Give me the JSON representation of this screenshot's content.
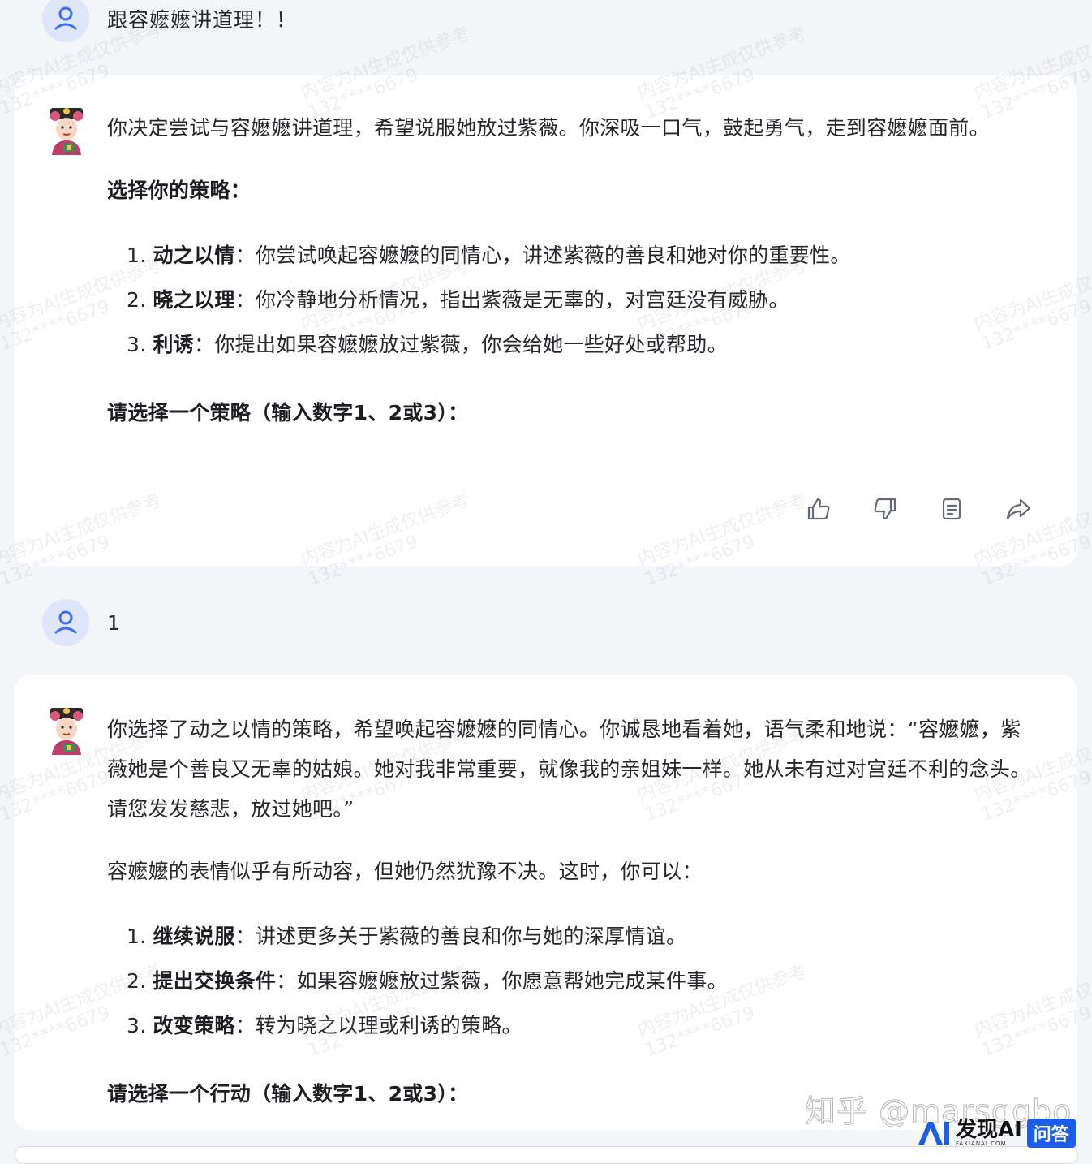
{
  "messages": {
    "user_1": {
      "text": "跟容嬷嬷讲道理！！"
    },
    "bot_1": {
      "intro": "你决定尝试与容嬷嬷讲道理，希望说服她放过紫薇。你深吸一口气，鼓起勇气，走到容嬷嬷面前。",
      "heading": "选择你的策略：",
      "options": [
        {
          "num": "1.",
          "title": "动之以情",
          "desc": "：你尝试唤起容嬷嬷的同情心，讲述紫薇的善良和她对你的重要性。"
        },
        {
          "num": "2.",
          "title": "晓之以理",
          "desc": "：你冷静地分析情况，指出紫薇是无辜的，对宫廷没有威胁。"
        },
        {
          "num": "3.",
          "title": "利诱",
          "desc": "：你提出如果容嬷嬷放过紫薇，你会给她一些好处或帮助。"
        }
      ],
      "prompt": "请选择一个策略（输入数字1、2或3）："
    },
    "user_2": {
      "text": "1"
    },
    "bot_2": {
      "intro": "你选择了动之以情的策略，希望唤起容嬷嬷的同情心。你诚恳地看着她，语气柔和地说：“容嬷嬷，紫薇她是个善良又无辜的姑娘。她对我非常重要，就像我的亲姐妹一样。她从未有过对宫廷不利的念头。请您发发慈悲，放过她吧。”",
      "followup": "容嬷嬷的表情似乎有所动容，但她仍然犹豫不决。这时，你可以：",
      "options": [
        {
          "num": "1.",
          "title": "继续说服",
          "desc": "：讲述更多关于紫薇的善良和你与她的深厚情谊。"
        },
        {
          "num": "2.",
          "title": "提出交换条件",
          "desc": "：如果容嬷嬷放过紫薇，你愿意帮她完成某件事。"
        },
        {
          "num": "3.",
          "title": "改变策略",
          "desc": "：转为晓之以理或利诱的策略。"
        }
      ],
      "prompt": "请选择一个行动（输入数字1、2或3）："
    }
  },
  "actions": {
    "like_icon": "thumbs-up-icon",
    "dislike_icon": "thumbs-down-icon",
    "copy_icon": "copy-icon",
    "share_icon": "share-icon"
  },
  "watermark": {
    "line1": "内容为AI生成仅供参考",
    "line2": "132****6679"
  },
  "branding": {
    "zhihu": "知乎 @marsggbo",
    "brand_name": "发现AI",
    "brand_sub": "FAXIANAI.COM",
    "brand_tag": "问答"
  },
  "colors": {
    "background": "#f4f5f9",
    "card": "#ffffff",
    "user_avatar_bg": "#dfe6fb",
    "user_avatar_fg": "#3d6df2",
    "brand_blue": "#1d5ee8"
  }
}
